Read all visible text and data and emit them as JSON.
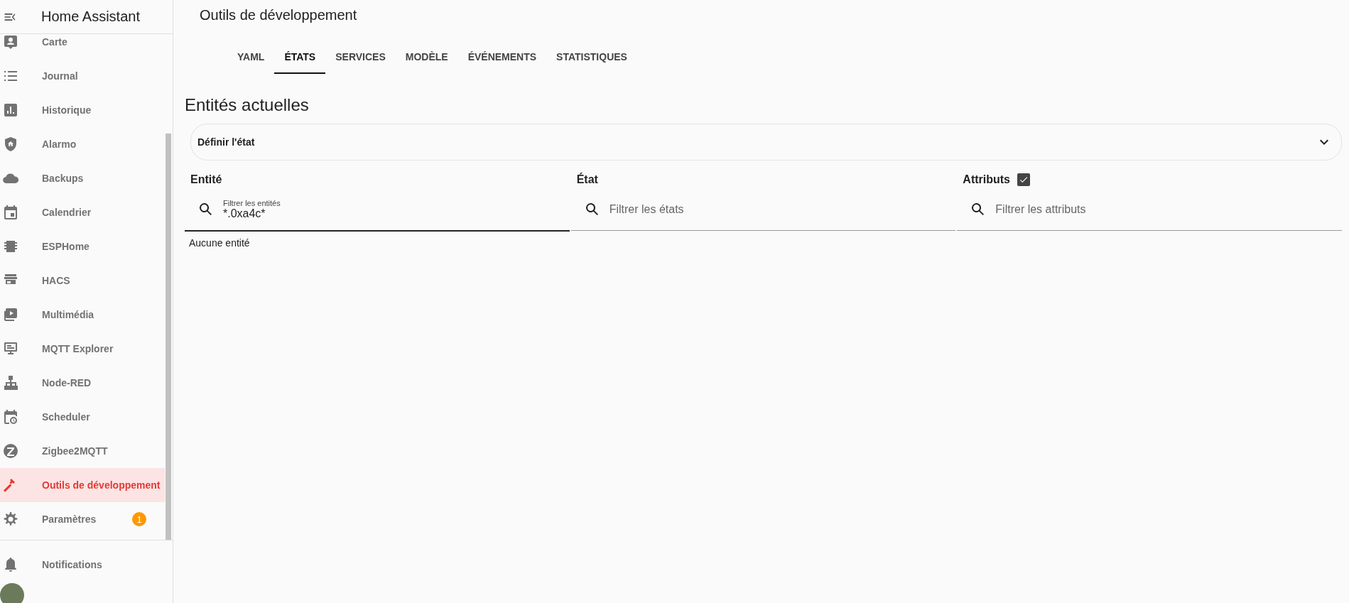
{
  "sidebar": {
    "title": "Home Assistant",
    "items": [
      {
        "label": "Carte",
        "selected": false
      },
      {
        "label": "Journal",
        "selected": false
      },
      {
        "label": "Historique",
        "selected": false
      },
      {
        "label": "Alarmo",
        "selected": false
      },
      {
        "label": "Backups",
        "selected": false
      },
      {
        "label": "Calendrier",
        "selected": false
      },
      {
        "label": "ESPHome",
        "selected": false
      },
      {
        "label": "HACS",
        "selected": false
      },
      {
        "label": "Multimédia",
        "selected": false
      },
      {
        "label": "MQTT Explorer",
        "selected": false
      },
      {
        "label": "Node-RED",
        "selected": false
      },
      {
        "label": "Scheduler",
        "selected": false
      },
      {
        "label": "Zigbee2MQTT",
        "selected": false
      },
      {
        "label": "Outils de développement",
        "selected": true
      },
      {
        "label": "Paramètres",
        "selected": false,
        "badge": "1"
      }
    ],
    "footer_items": [
      {
        "label": "Notifications"
      }
    ]
  },
  "page": {
    "title": "Outils de développement",
    "tabs": [
      {
        "label": "YAML",
        "selected": false
      },
      {
        "label": "ÉTATS",
        "selected": true
      },
      {
        "label": "SERVICES",
        "selected": false
      },
      {
        "label": "MODÈLE",
        "selected": false
      },
      {
        "label": "ÉVÉNEMENTS",
        "selected": false
      },
      {
        "label": "STATISTIQUES",
        "selected": false
      }
    ],
    "heading": "Entités actuelles",
    "expander": {
      "label": "Définir l'état",
      "expanded": false
    },
    "columns": [
      {
        "header": "Entité",
        "filter": {
          "label": "Filtrer les entités",
          "value": "*.0xa4c*",
          "focused": true
        }
      },
      {
        "header": "État",
        "filter": {
          "placeholder": "Filtrer les états",
          "focused": false
        }
      },
      {
        "header": "Attributs",
        "checked": true,
        "filter": {
          "placeholder": "Filtrer les attributs",
          "focused": false
        }
      }
    ],
    "empty_message": "Aucune entité"
  }
}
